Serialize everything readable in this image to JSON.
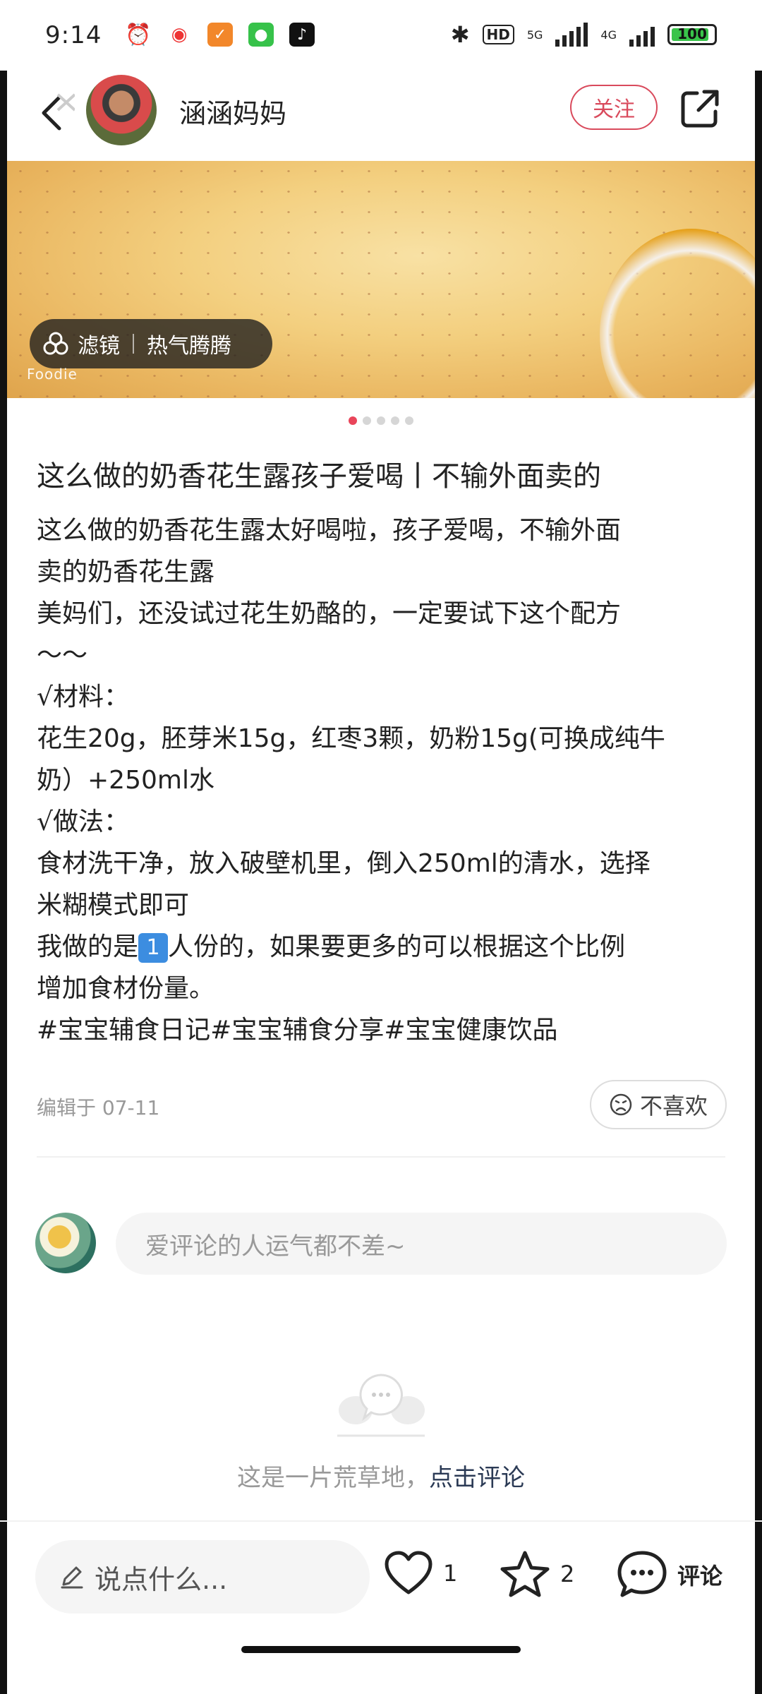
{
  "status_bar": {
    "time": "9:14",
    "network_5g": "5G",
    "network_4g": "4G",
    "hd": "HD",
    "battery": "100"
  },
  "header": {
    "username": "涵涵妈妈",
    "follow_label": "关注"
  },
  "hero": {
    "filter_label": "滤镜",
    "filter_name": "热气腾腾",
    "watermark": "Foodie",
    "page_count": 5,
    "current_page": 1
  },
  "post": {
    "title": "这么做的奶香花生露孩子爱喝丨不输外面卖的",
    "lines": [
      "这么做的奶香花生露太好喝啦，孩子爱喝，不输外面",
      "卖的奶香花生露",
      "美妈们，还没试过花生奶酪的，一定要试下这个配方",
      "～～",
      "√材料：",
      "花生20g，胚芽米15g，红枣3颗，奶粉15g(可换成纯牛",
      "奶）+250ml水",
      "√做法：",
      "食材洗干净，放入破壁机里，倒入250ml的清水，选择",
      "米糊模式即可"
    ],
    "line_portion_before_emoji": "我做的是",
    "emoji_keycap": "1",
    "line_portion_after_emoji": "人份的，如果要更多的可以根据这个比例",
    "line_after": "增加食材份量。",
    "tags": "#宝宝辅食日记#宝宝辅食分享#宝宝健康饮品",
    "edited": "编辑于 07-11",
    "dislike_label": "不喜欢"
  },
  "comments": {
    "input_placeholder": "爱评论的人运气都不差~",
    "empty_text": "这是一片荒草地，",
    "empty_link": "点击评论"
  },
  "bottom_bar": {
    "say_placeholder": "说点什么...",
    "like_count": "1",
    "star_count": "2",
    "comment_label": "评论"
  },
  "colors": {
    "accent": "#d94a5c",
    "pager_active": "#e9455a"
  }
}
